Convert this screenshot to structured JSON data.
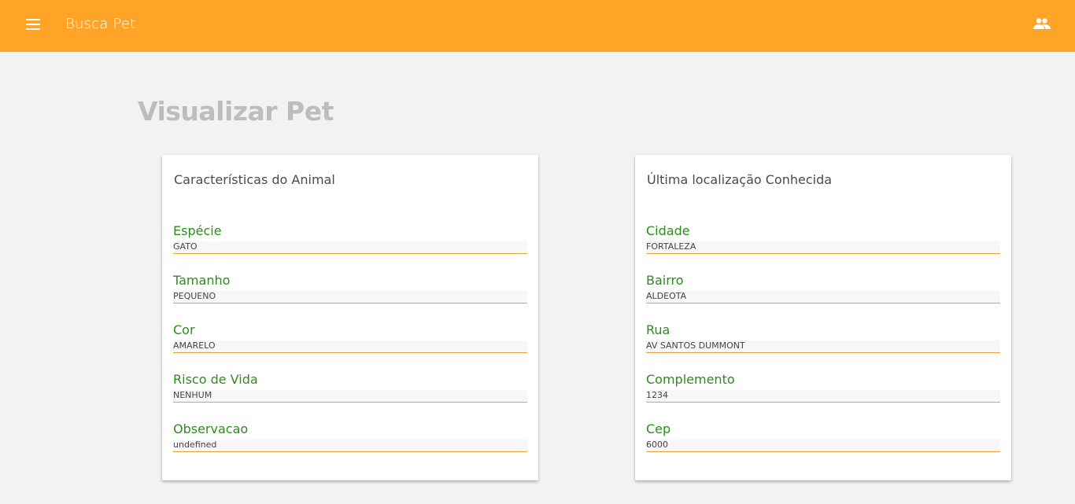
{
  "app": {
    "title": "Busca Pet",
    "menu_icon": "menu-icon",
    "account_icon": "people-icon",
    "accent_color": "#ffa426"
  },
  "page": {
    "title": "Visualizar Pet"
  },
  "animal_card": {
    "title": "Características do Animal",
    "fields": [
      {
        "label": "Espécie",
        "value": "GATO"
      },
      {
        "label": "Tamanho",
        "value": "PEQUENO"
      },
      {
        "label": "Cor",
        "value": "AMARELO"
      },
      {
        "label": "Risco de Vida",
        "value": "NENHUM"
      },
      {
        "label": "Observacao",
        "value": "undefined"
      }
    ]
  },
  "location_card": {
    "title": "Última localização Conhecida",
    "fields": [
      {
        "label": "Cidade",
        "value": "FORTALEZA"
      },
      {
        "label": "Bairro",
        "value": "ALDEOTA"
      },
      {
        "label": "Rua",
        "value": "AV SANTOS DUMMONT"
      },
      {
        "label": "Complemento",
        "value": "1234"
      },
      {
        "label": "Cep",
        "value": "6000"
      }
    ]
  }
}
